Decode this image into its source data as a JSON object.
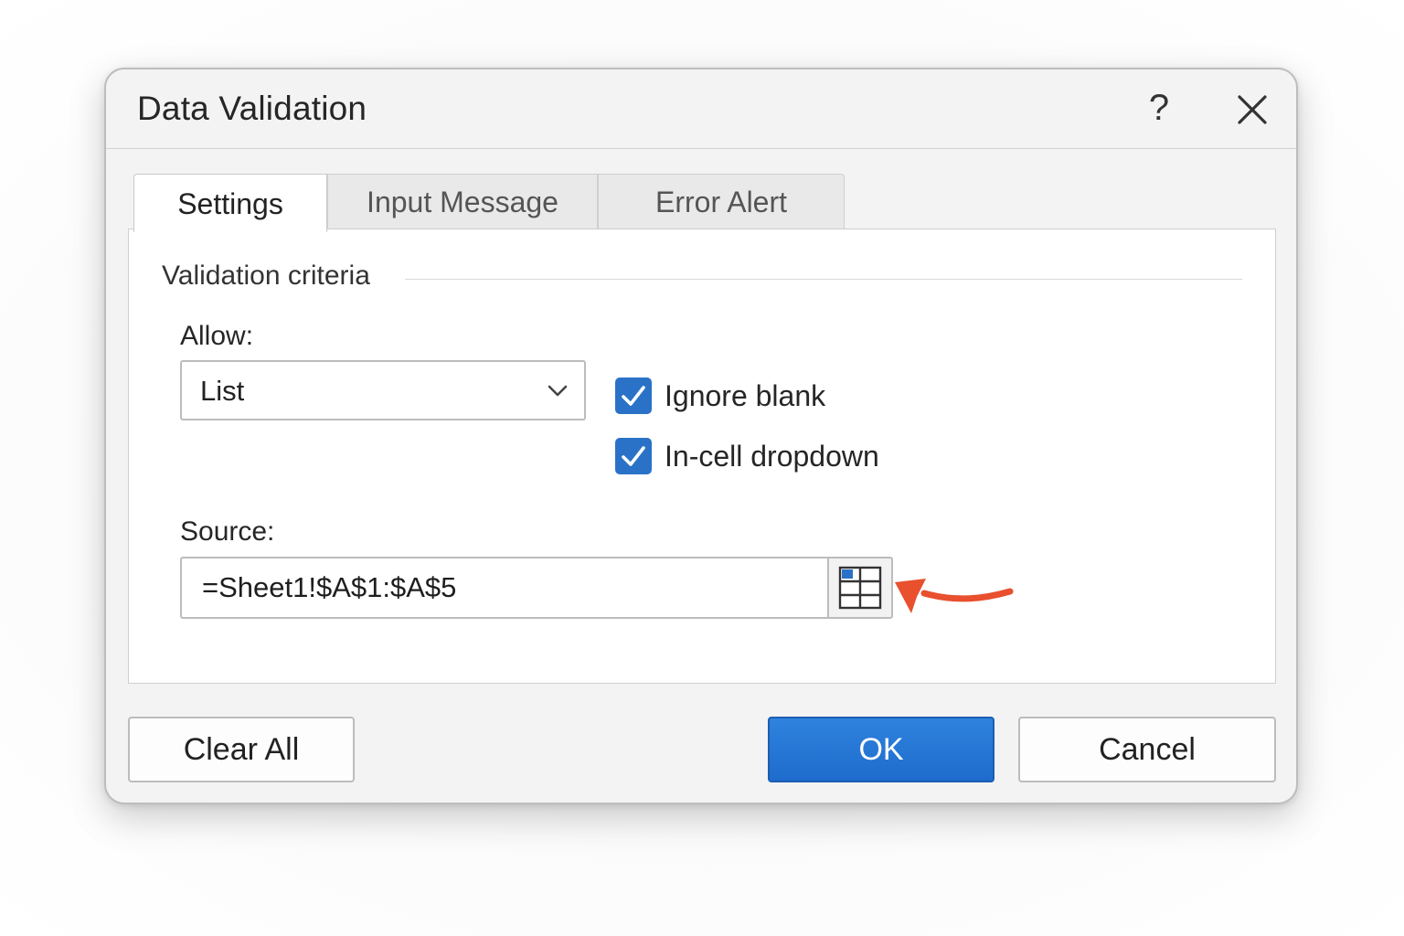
{
  "dialog": {
    "title": "Data Validation",
    "help_label": "?"
  },
  "tabs": [
    {
      "label": "Settings",
      "active": true
    },
    {
      "label": "Input Message",
      "active": false
    },
    {
      "label": "Error Alert",
      "active": false
    }
  ],
  "settings": {
    "group_label": "Validation criteria",
    "allow": {
      "label": "Allow:",
      "value": "List"
    },
    "checkboxes": [
      {
        "label": "Ignore blank",
        "checked": true
      },
      {
        "label": "In-cell dropdown",
        "checked": true
      }
    ],
    "source": {
      "label": "Source:",
      "value": "=Sheet1!$A$1:$A$5"
    }
  },
  "buttons": {
    "clear_all": "Clear All",
    "ok": "OK",
    "cancel": "Cancel"
  },
  "icons": {
    "help": "question-mark-icon",
    "close": "close-icon",
    "dropdown": "chevron-down-icon",
    "checkbox": "checkmark-icon",
    "range_selector": "range-selector-grid-icon",
    "annotation": "red-arrow-icon"
  },
  "colors": {
    "accent": "#2a72c7",
    "ok_button": "#1e6ccd",
    "annotation_arrow": "#e8502e",
    "range_icon_fill": "#2a72c7"
  }
}
